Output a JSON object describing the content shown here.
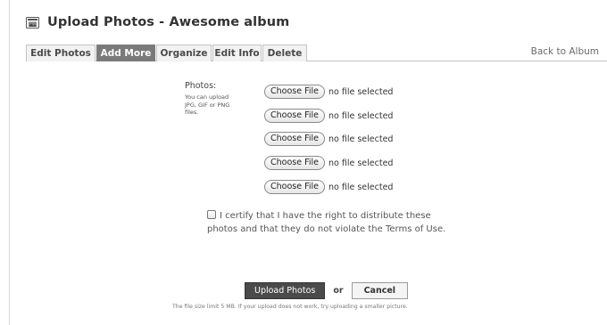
{
  "header": {
    "title": "Upload Photos - Awesome album",
    "icon": "photo-album-icon"
  },
  "tabs": [
    {
      "label": "Edit Photos",
      "active": false
    },
    {
      "label": "Add More",
      "active": true
    },
    {
      "label": "Organize",
      "active": false
    },
    {
      "label": "Edit Info",
      "active": false
    },
    {
      "label": "Delete",
      "active": false
    }
  ],
  "back_link": "Back to Album",
  "photos": {
    "label": "Photos:",
    "help": "You can upload JPG, GIF or PNG files."
  },
  "file_inputs": [
    {
      "button": "Choose File",
      "status": "no file selected"
    },
    {
      "button": "Choose File",
      "status": "no file selected"
    },
    {
      "button": "Choose File",
      "status": "no file selected"
    },
    {
      "button": "Choose File",
      "status": "no file selected"
    },
    {
      "button": "Choose File",
      "status": "no file selected"
    }
  ],
  "certify_text": "I certify that I have the right to distribute these photos and that they do not violate the Terms of Use.",
  "actions": {
    "upload_label": "Upload Photos",
    "or_label": "or",
    "cancel_label": "Cancel"
  },
  "limit_note": "The file size limit 5 MB. If your upload does not work, try uploading a smaller picture."
}
